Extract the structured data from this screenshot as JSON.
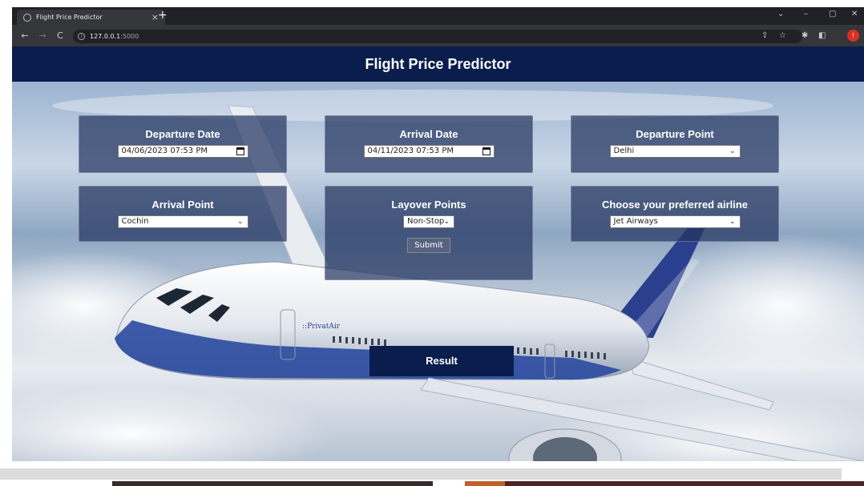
{
  "browser": {
    "tab_title": "Flight Price Predictor",
    "tab_close": "×",
    "new_tab": "+",
    "url_host": "127.0.0.1",
    "url_port": ":5000"
  },
  "header": {
    "title": "Flight Price Predictor"
  },
  "form": {
    "departure_date": {
      "label": "Departure Date",
      "value": "04/06/2023 07:53 PM"
    },
    "arrival_date": {
      "label": "Arrival Date",
      "value": "04/11/2023 07:53 PM"
    },
    "departure_point": {
      "label": "Departure Point",
      "value": "Delhi"
    },
    "arrival_point": {
      "label": "Arrival Point",
      "value": "Cochin"
    },
    "layover": {
      "label": "Layover Points",
      "value": "Non-Stop"
    },
    "airline": {
      "label": "Choose your preferred airline",
      "value": "Jet Airways"
    },
    "submit_label": "Submit"
  },
  "result": {
    "label": "Result"
  },
  "airplane_livery": "PrivatAir",
  "colors": {
    "header_bg": "#0b1d4d",
    "card_bg": "#243460",
    "accent_profile": "#d93025"
  }
}
